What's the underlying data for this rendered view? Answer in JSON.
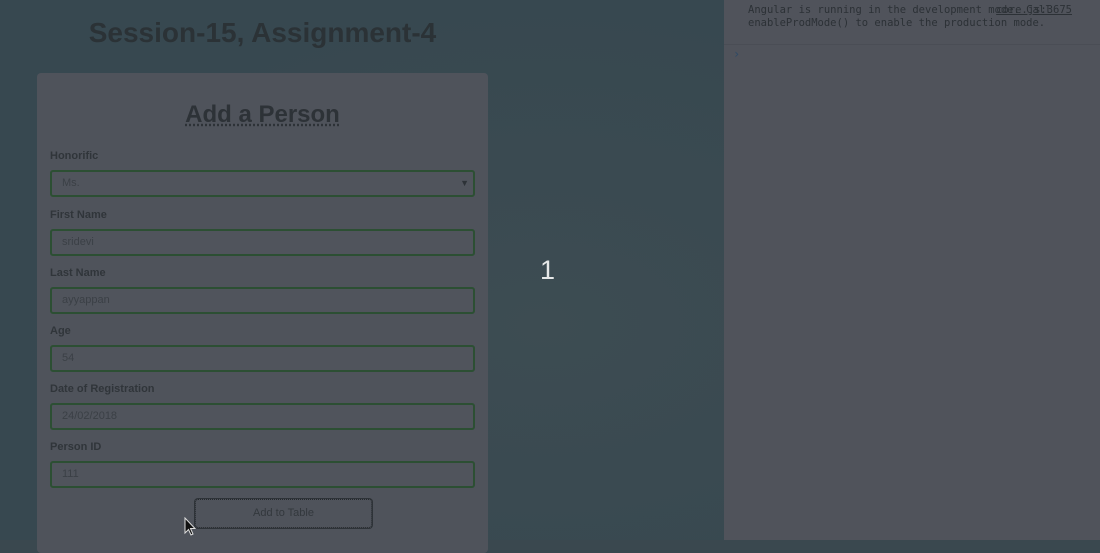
{
  "page": {
    "title": "Session-15, Assignment-4",
    "counter": "1"
  },
  "form": {
    "title": "Add a Person",
    "fields": [
      {
        "label": "Honorific",
        "value": "Ms.",
        "type": "select"
      },
      {
        "label": "First Name",
        "value": "sridevi"
      },
      {
        "label": "Last Name",
        "value": "ayyappan"
      },
      {
        "label": "Age",
        "value": "54"
      },
      {
        "label": "Date of Registration",
        "value": "24/02/2018"
      },
      {
        "label": "Person ID",
        "value": "111"
      }
    ],
    "submit_label": "Add to Table"
  },
  "console": {
    "message": "Angular is running in the development mode. Call enableProdMode() to enable the production mode.",
    "source": "core.js:3675",
    "prompt": "›"
  },
  "colors": {
    "background": "#374850",
    "card": "#4f535b",
    "input_border": "#2c4f33",
    "console": "#50535b"
  }
}
